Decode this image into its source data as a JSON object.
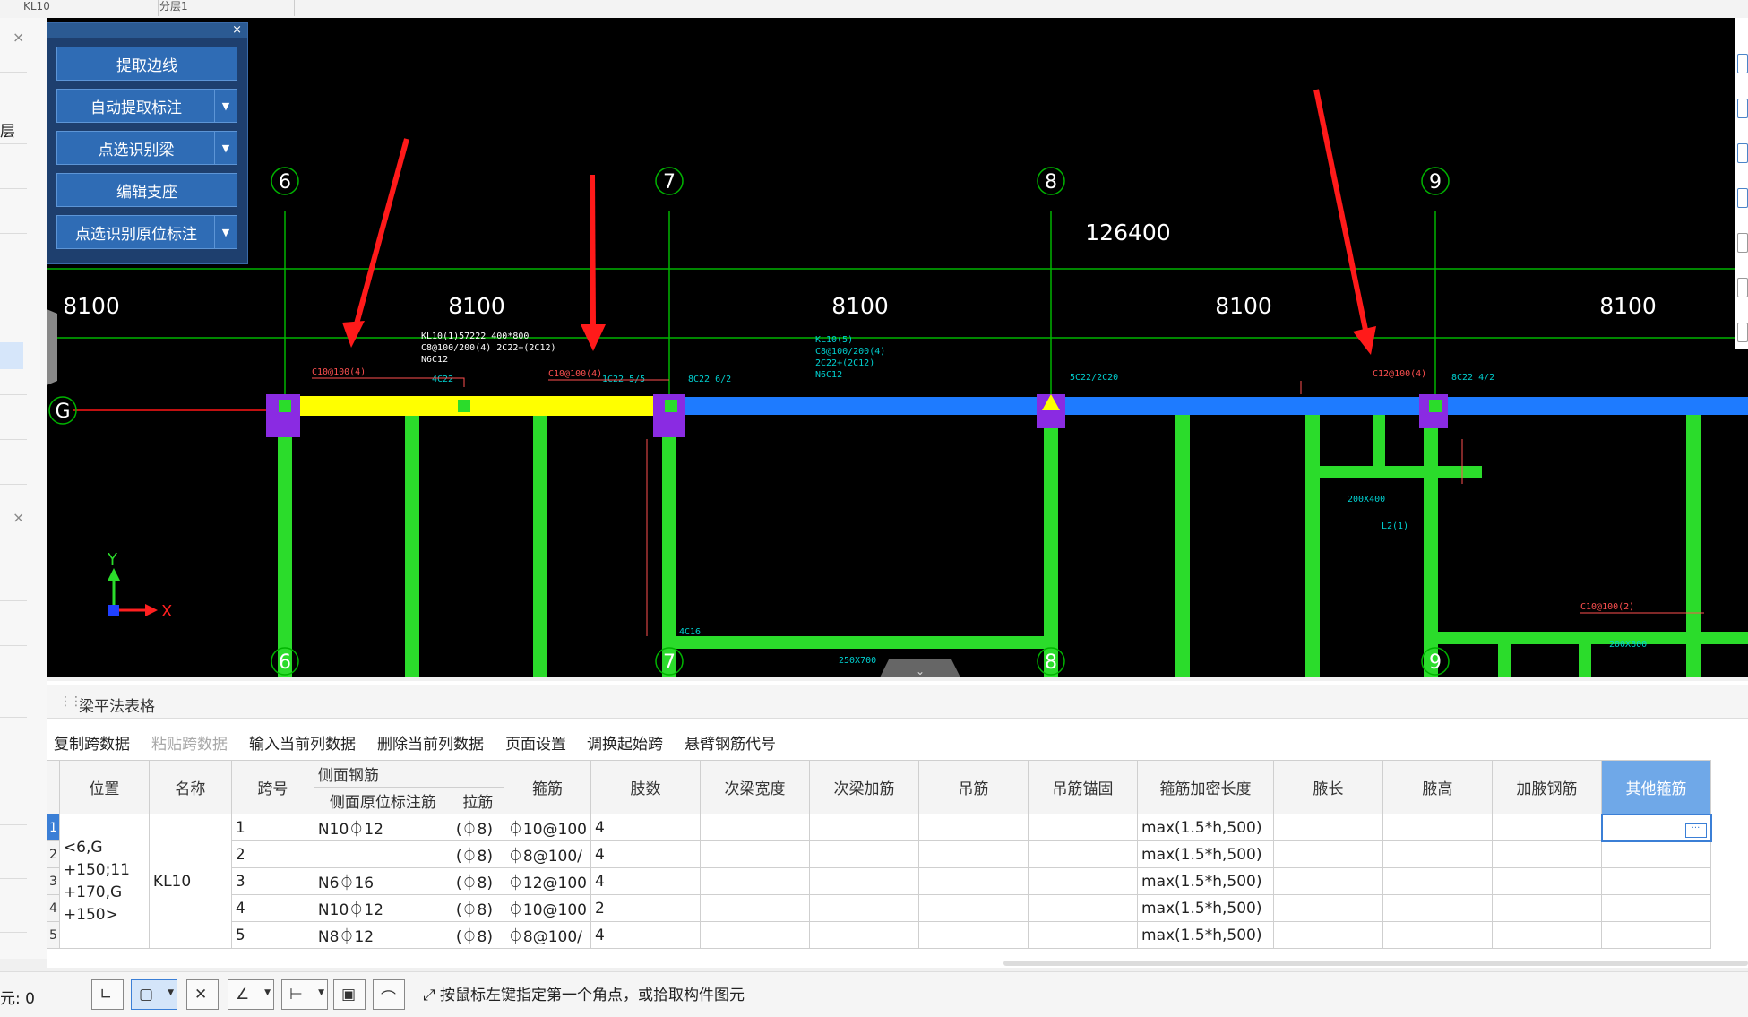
{
  "top_selectors": [
    "KL10",
    "分层1"
  ],
  "left_dock": {
    "layer_label": "层",
    "close_glyph": "×",
    "collapse_glyph": "‹"
  },
  "panel": {
    "close_glyph": "×",
    "buttons": [
      {
        "label": "提取边线",
        "dropdown": false
      },
      {
        "label": "自动提取标注",
        "dropdown": true
      },
      {
        "label": "点选识别梁",
        "dropdown": true
      },
      {
        "label": "编辑支座",
        "dropdown": false
      },
      {
        "label": "点选识别原位标注",
        "dropdown": true
      }
    ],
    "dropdown_glyph": "▼"
  },
  "cad": {
    "axes": [
      "6",
      "7",
      "8",
      "9"
    ],
    "row_axis": "G",
    "total_dim": "126400",
    "span_dims": [
      "8100",
      "8100",
      "8100",
      "8100",
      "8100"
    ],
    "ucs": {
      "x": "X",
      "y": "Y"
    },
    "colors": {
      "beam_selected": "#ffff00",
      "beam_other": "#1e7bff",
      "column": "#8a2be2",
      "wall": "#2bdc2b",
      "grid": "#00b400",
      "annot": "#00d0d0",
      "annot_red": "#ff5050",
      "arrow": "#ff1a1a"
    },
    "annotations": {
      "a1": "KL10(1)57222 400*800",
      "a2": "C8@100/200(4) 2C22+(2C12)",
      "a3": "N6C12",
      "a4": "C10@100(4)",
      "a5": "4C22",
      "a6": "C10@100(4)",
      "a7": "1C22 5/5",
      "a8": "8C22 6/2",
      "a9": "KL10(5)",
      "a10": "C8@100/200(4)",
      "a11": "2C22+(2C12)",
      "a12": "N6C12",
      "a13": "5C22/2C20",
      "a14": "C12@100(4)",
      "a15": "8C22 4/2",
      "a16": "200X400",
      "a17": "250X700",
      "a18": "200X800",
      "a19": "4C16",
      "a20": "L2(1)",
      "a21": "C10@100(2)"
    },
    "expand_glyph": "⌄"
  },
  "table": {
    "title": "梁平法表格",
    "grip": "⋮⋮",
    "toolbar": [
      {
        "label": "复制跨数据",
        "disabled": false
      },
      {
        "label": "粘贴跨数据",
        "disabled": true
      },
      {
        "label": "输入当前列数据",
        "disabled": false
      },
      {
        "label": "删除当前列数据",
        "disabled": false
      },
      {
        "label": "页面设置",
        "disabled": false
      },
      {
        "label": "调换起始跨",
        "disabled": false
      },
      {
        "label": "悬臂钢筋代号",
        "disabled": false
      }
    ],
    "headers": {
      "position": "位置",
      "name": "名称",
      "span": "跨号",
      "side_group": "侧面钢筋",
      "side_orig": "侧面原位标注筋",
      "tie": "拉筋",
      "stirrup": "箍筋",
      "legs": "肢数",
      "sec_width": "次梁宽度",
      "sec_add": "次梁加筋",
      "hanger": "吊筋",
      "hanger_anchor": "吊筋锚固",
      "dense_len": "箍筋加密长度",
      "haunch_len": "腋长",
      "haunch_h": "腋高",
      "haunch_bar": "加腋钢筋",
      "other_stirrup": "其他箍筋"
    },
    "position_value": "<6,G\n+150;11\n+170,G\n+150>",
    "name_value": "KL10",
    "rows": [
      {
        "num": "1",
        "span": "1",
        "side_orig": "N10⏀12",
        "tie": "(⏀8)",
        "stirrup": "⏀10@100",
        "legs": "4",
        "dense_len": "max(1.5*h,500)"
      },
      {
        "num": "2",
        "span": "2",
        "side_orig": "",
        "tie": "(⏀8)",
        "stirrup": "⏀8@100/",
        "legs": "4",
        "dense_len": "max(1.5*h,500)"
      },
      {
        "num": "3",
        "span": "3",
        "side_orig": "N6⏀16",
        "tie": "(⏀8)",
        "stirrup": "⏀12@100",
        "legs": "4",
        "dense_len": "max(1.5*h,500)"
      },
      {
        "num": "4",
        "span": "4",
        "side_orig": "N10⏀12",
        "tie": "(⏀8)",
        "stirrup": "⏀10@100",
        "legs": "2",
        "dense_len": "max(1.5*h,500)"
      },
      {
        "num": "5",
        "span": "5",
        "side_orig": "N8⏀12",
        "tie": "(⏀8)",
        "stirrup": "⏀8@100/",
        "legs": "4",
        "dense_len": "max(1.5*h,500)"
      }
    ],
    "ellipsis": "···"
  },
  "status": {
    "count_text": "元: 0",
    "hint": "按鼠标左键指定第一个角点，或拾取构件图元",
    "hint_icon": "⤢"
  }
}
